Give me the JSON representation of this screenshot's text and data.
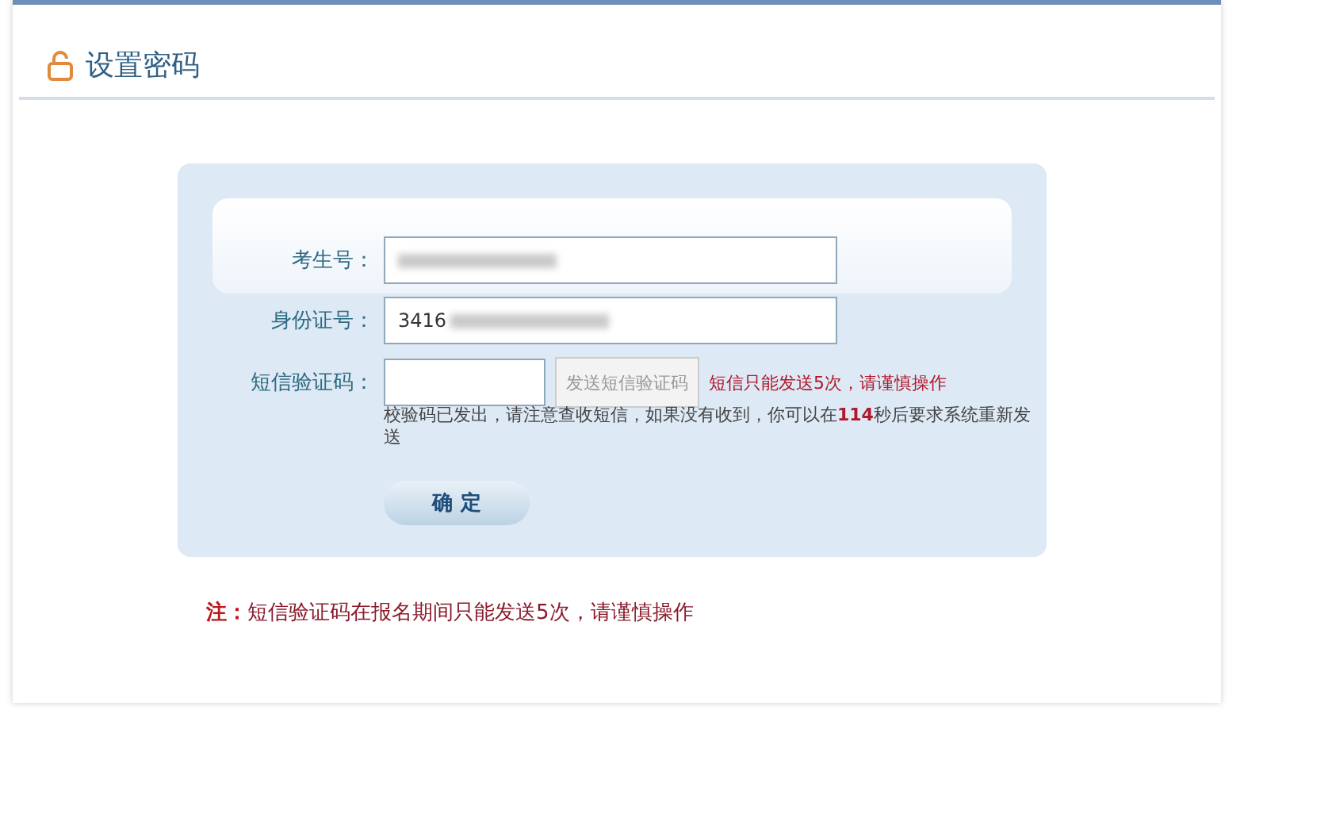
{
  "header": {
    "title": "设置密码"
  },
  "form": {
    "fields": [
      {
        "kind": "text",
        "label": "考生号：",
        "redacted": true
      },
      {
        "kind": "text",
        "label": "身份证号：",
        "value": "3416",
        "redacted": true
      },
      {
        "kind": "sms",
        "label": "短信验证码：",
        "send_button": {
          "label": "发送短信验证码",
          "disabled": true
        },
        "warning": "短信只能发送5次，请谨慎操作",
        "hint": "校验码已发出，请注意查收短信，如果没有收到，你可以在**114**秒后要求系统重新发送"
      }
    ],
    "submit": "确 定"
  },
  "note": "**注：**短信验证码在报名期间只能发送5次，请谨慎操作"
}
